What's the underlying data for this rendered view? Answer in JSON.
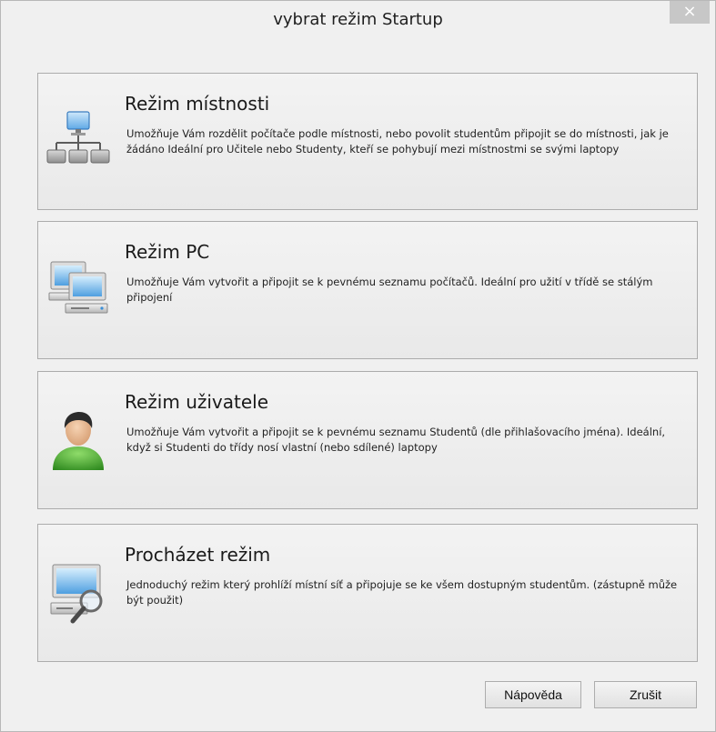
{
  "dialog": {
    "title": "vybrat režim Startup",
    "close_label": "×"
  },
  "modes": [
    {
      "title": "Režim místnosti",
      "description": "Umožňuje Vám rozdělit počítače podle místnosti, nebo povolit studentům připojit se do místnosti, jak je žádáno Ideální pro Učitele nebo Studenty, kteří se pohybují mezi místnostmi se svými laptopy",
      "icon": "network-hierarchy-icon"
    },
    {
      "title": "Režim PC",
      "description": "Umožňuje Vám vytvořit a připojit se k pevnému seznamu počítačů. Ideální pro užití v třídě se stálým připojení",
      "icon": "computers-icon"
    },
    {
      "title": "Režim uživatele",
      "description": "Umožňuje Vám vytvořit a připojit se k pevnému seznamu Studentů (dle přihlašovacího jména). Ideální, když si Studenti do třídy nosí vlastní (nebo sdílené) laptopy",
      "icon": "user-icon"
    },
    {
      "title": "Procházet režim",
      "description": "Jednoduchý režim který prohlíží místní síť a připojuje se ke všem dostupným studentům. (zástupně může být použit)",
      "icon": "browse-computer-icon"
    }
  ],
  "buttons": {
    "help_label": "Nápověda",
    "cancel_label": "Zrušit"
  }
}
